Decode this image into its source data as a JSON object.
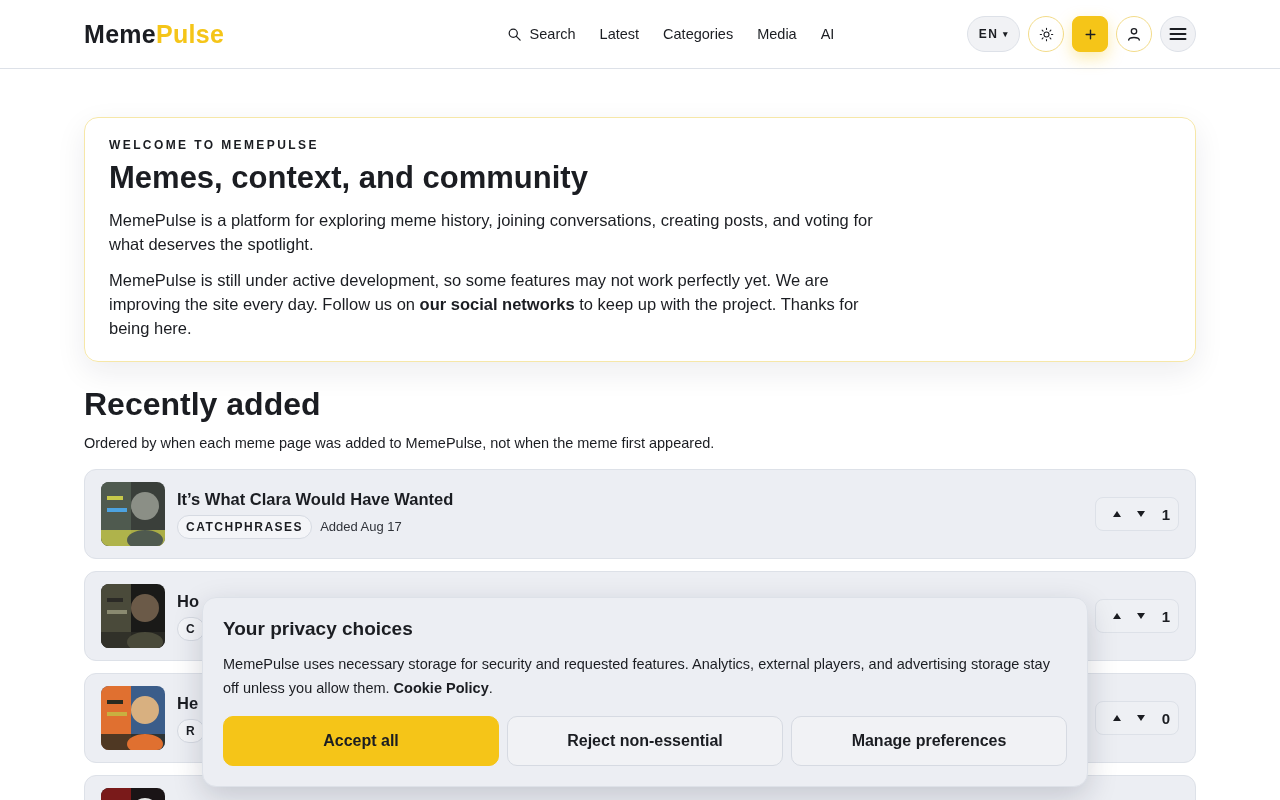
{
  "header": {
    "logo": {
      "first": "Meme",
      "second": "Pulse"
    },
    "nav": [
      {
        "label": "Search",
        "kind": "search"
      },
      {
        "label": "Latest",
        "kind": "link"
      },
      {
        "label": "Categories",
        "kind": "link"
      },
      {
        "label": "Media",
        "kind": "link"
      },
      {
        "label": "AI",
        "kind": "link"
      }
    ],
    "language": "EN",
    "language_caret": "▾"
  },
  "welcome": {
    "eyebrow": "WELCOME TO MEMEPULSE",
    "title": "Memes, context, and community",
    "paragraphs": [
      "MemePulse is a platform for exploring meme history, joining conversations, creating posts, and voting for what deserves the spotlight.",
      "MemePulse is still under active development, so some features may not work perfectly yet. We are improving the site every day. Follow us on **our social networks** to keep up with the project. Thanks for being here."
    ]
  },
  "recent": {
    "title": "Recently added",
    "subtitle": "Ordered by when each meme page was added to MemePulse, not when the meme first appeared.",
    "items": [
      {
        "title": "It’s What Clara Would Have Wanted",
        "tag": "CATCHPHRASES",
        "added": "Added Aug 17",
        "votes": "1",
        "thumb": {
          "kind": "picture"
        }
      },
      {
        "title": "Ho",
        "tag": "C",
        "votes": "1",
        "thumb": {
          "kind": "picture"
        }
      },
      {
        "title": "He",
        "tag": "R",
        "votes": "0",
        "thumb": {
          "kind": "picture"
        }
      },
      {
        "thumb": {
          "kind": "picture"
        }
      }
    ]
  },
  "cookie_banner": {
    "title": "Your privacy choices",
    "text": "MemePulse uses necessary storage for security and requested features. Analytics, external players, and advertising storage stay off unless you allow them.",
    "link": "Cookie Policy",
    "link_end": ".",
    "buttons": [
      {
        "label": "Accept all",
        "kind": "primary"
      },
      {
        "label": "Reject non-essential",
        "kind": "secondary"
      },
      {
        "label": "Manage preferences",
        "kind": "secondary"
      }
    ]
  }
}
